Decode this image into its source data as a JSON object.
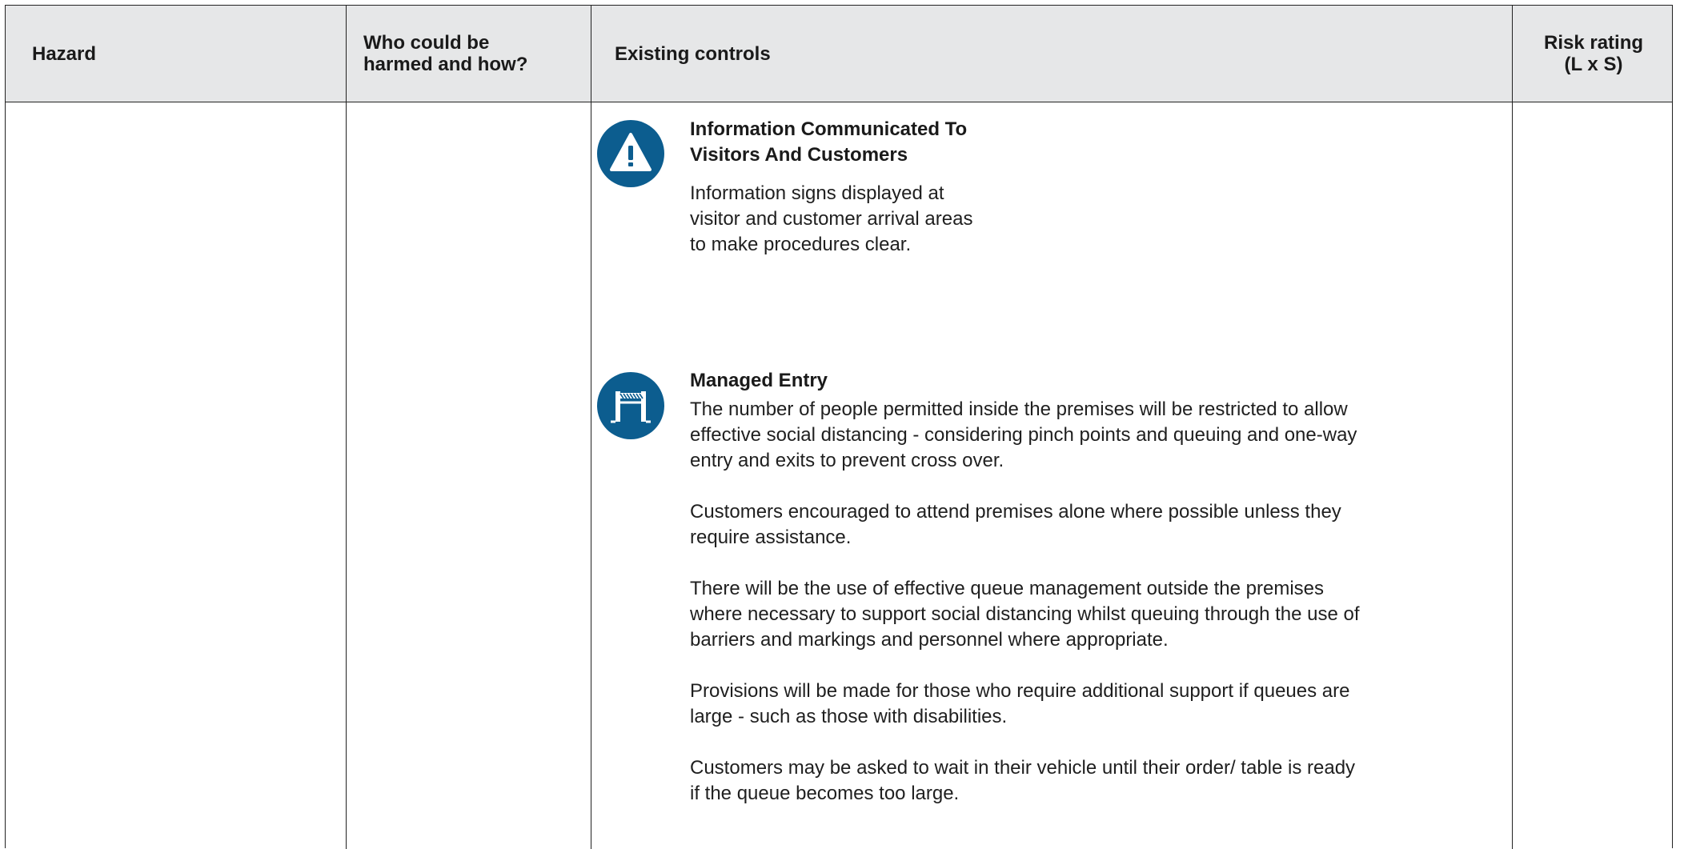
{
  "header": {
    "hazard": "Hazard",
    "who_harmed_line1": "Who could be",
    "who_harmed_line2": "harmed and how?",
    "existing_controls": "Existing controls",
    "risk_rating_line1": "Risk rating",
    "risk_rating_line2": "(L x S)"
  },
  "controls": [
    {
      "icon": "warning-icon",
      "title_line1": "Information Communicated To",
      "title_line2": "Visitors And Customers",
      "lines": [
        "Information signs displayed at",
        "visitor and customer arrival areas",
        "to make procedures clear."
      ]
    },
    {
      "icon": "barrier-gate-icon",
      "title": "Managed Entry",
      "paragraphs": [
        [
          "The number of people permitted inside the premises will be restricted to allow",
          "effective social distancing - considering pinch points and queuing and one-way",
          "entry and exits to prevent cross over."
        ],
        [
          "Customers encouraged to attend premises alone where possible unless they",
          "require assistance."
        ],
        [
          "There will be the use of effective queue management outside the premises",
          "where necessary to support social distancing whilst queuing through the use of",
          "barriers and markings and personnel where appropriate."
        ],
        [
          "Provisions will be made for those who require additional support if queues are",
          "large - such as those with disabilities."
        ],
        [
          "Customers may be asked to wait in their vehicle until their order/ table is ready",
          "if the queue becomes too large."
        ]
      ]
    }
  ],
  "colors": {
    "header_bg": "#e6e7e8",
    "icon_blue": "#0c5d8f"
  }
}
